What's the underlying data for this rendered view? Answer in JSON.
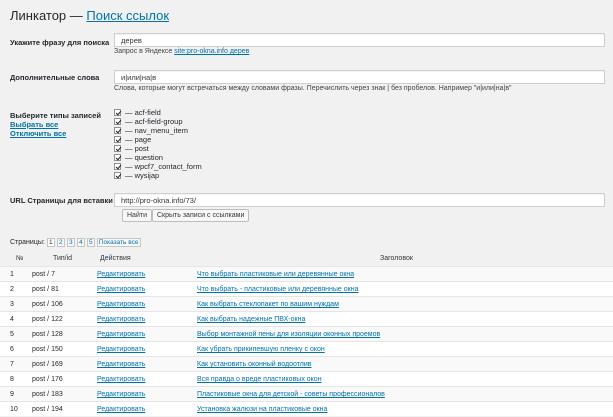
{
  "header": {
    "title": "Линкатор —",
    "title_link": "Поиск ссылок"
  },
  "phrase": {
    "label": "Укажите фразу для поиска",
    "value": "дерев",
    "hint_prefix": "Запрос в Яндексе",
    "hint_link": "site:pro-okna.info дерев"
  },
  "extra": {
    "label": "Дополнительные слова",
    "value": "и|или|на|в",
    "hint": "Слова, которые могут встречаться между словами фразы. Перечислить через знак | без пробелов. Например \"и|или|на|в\""
  },
  "types": {
    "label": "Выберите типы записей",
    "select_all": "Выбрать все",
    "deselect_all": "Отключить все",
    "items": [
      "— acf-field",
      "— acf-field-group",
      "— nav_menu_item",
      "— page",
      "— post",
      "— question",
      "— wpcf7_contact_form",
      "— wysijap"
    ]
  },
  "url": {
    "label": "URL Страницы для вставки",
    "value": "http://pro-okna.info/73/",
    "find_button": "Найти",
    "hide_button": "Скрыть записи с ссылками"
  },
  "pager": {
    "label": "Страницы:",
    "pages": [
      "1",
      "2",
      "3",
      "4",
      "5"
    ],
    "show_all": "Показать все"
  },
  "table": {
    "headers": {
      "num": "№",
      "type": "Тип/id",
      "actions": "Действия",
      "title": "Заголовок"
    },
    "rows": [
      {
        "num": "1",
        "type": "post / 7",
        "action": "Редактировать",
        "title": "Что выбрать пластиковые или деревянные окна"
      },
      {
        "num": "2",
        "type": "post / 81",
        "action": "Редактировать",
        "title": "Что выбрать - пластиковые или деревянные окна"
      },
      {
        "num": "3",
        "type": "post / 106",
        "action": "Редактировать",
        "title": "Как выбрать стеклопакет по вашим нуждам"
      },
      {
        "num": "4",
        "type": "post / 122",
        "action": "Редактировать",
        "title": "Как выбрать надежные ПВХ-окна"
      },
      {
        "num": "5",
        "type": "post / 128",
        "action": "Редактировать",
        "title": "Выбор монтажной пены для изоляции оконных проемов"
      },
      {
        "num": "6",
        "type": "post / 150",
        "action": "Редактировать",
        "title": "Как убрать прикипевшую пленку с окон"
      },
      {
        "num": "7",
        "type": "post / 169",
        "action": "Редактировать",
        "title": "Как установить оконный водоотлив"
      },
      {
        "num": "8",
        "type": "post / 176",
        "action": "Редактировать",
        "title": "Вся правда о вреде пластиковых окон"
      },
      {
        "num": "9",
        "type": "post / 183",
        "action": "Редактировать",
        "title": "Пластиковые окна для детской - советы профессионалов"
      },
      {
        "num": "10",
        "type": "post / 194",
        "action": "Редактировать",
        "title": "Установка жалюзи на пластиковые окна"
      }
    ]
  }
}
